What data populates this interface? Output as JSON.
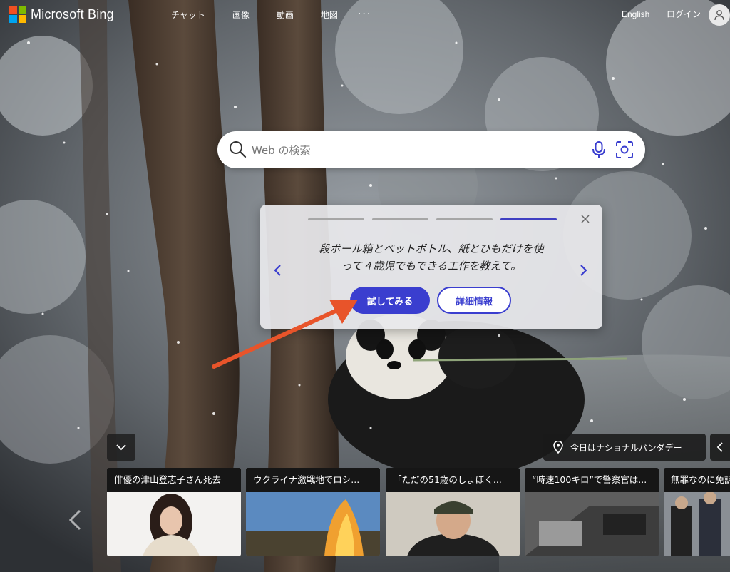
{
  "header": {
    "logo_text": "Microsoft Bing",
    "nav": [
      "チャット",
      "画像",
      "動画",
      "地図"
    ],
    "more": "···",
    "language": "English",
    "login": "ログイン"
  },
  "search": {
    "placeholder": "Web の検索"
  },
  "prompt_card": {
    "text_line1": "段ボール箱とペットボトル、紙とひもだけを使",
    "text_line2": "って４歳児でもできる工作を教えて。",
    "try_label": "試してみる",
    "more_label": "詳細情報",
    "progress_steps": 4,
    "active_step": 4
  },
  "bottom": {
    "location_label": "今日はナショナルパンダデー",
    "news": [
      {
        "title": "俳優の津山登志子さん死去"
      },
      {
        "title": "ウクライナ激戦地でロシ..."
      },
      {
        "title": "「ただの51歳のしょぼく..."
      },
      {
        "title": "“時速100キロ”で警察官は..."
      },
      {
        "title": "無罪なのに免訴"
      }
    ]
  },
  "colors": {
    "accent": "#3a3ecf",
    "annotation_arrow": "#e8542a"
  },
  "icons": [
    "microsoft-logo-icon",
    "user-icon",
    "search-icon",
    "microphone-icon",
    "visual-search-icon",
    "close-icon",
    "chevron-left-icon",
    "chevron-right-icon",
    "chevron-down-icon",
    "location-pin-icon"
  ]
}
